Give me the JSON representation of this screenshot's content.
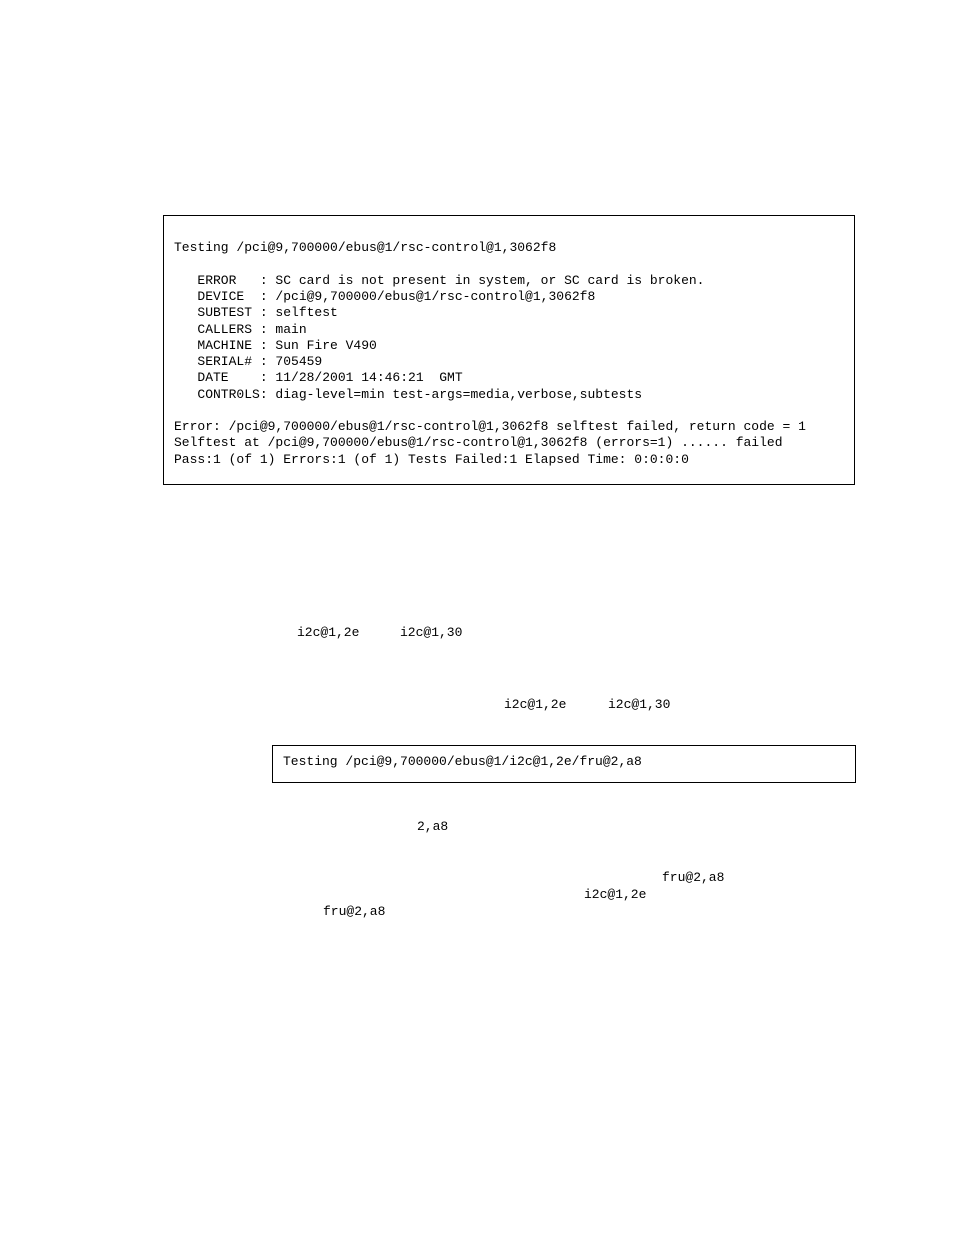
{
  "codebox1": "\nTesting /pci@9,700000/ebus@1/rsc-control@1,3062f8\n\n   ERROR   : SC card is not present in system, or SC card is broken.\n   DEVICE  : /pci@9,700000/ebus@1/rsc-control@1,3062f8\n   SUBTEST : selftest\n   CALLERS : main\n   MACHINE : Sun Fire V490\n   SERIAL# : 705459\n   DATE    : 11/28/2001 14:46:21  GMT\n   CONTR0LS: diag-level=min test-args=media,verbose,subtests\n\nError: /pci@9,700000/ebus@1/rsc-control@1,3062f8 selftest failed, return code = 1\nSelftest at /pci@9,700000/ebus@1/rsc-control@1,3062f8 (errors=1) ...... failed\nPass:1 (of 1) Errors:1 (of 1) Tests Failed:1 Elapsed Time: 0:0:0:0",
  "line1a": "i2c@1,2e",
  "line1b": "i2c@1,30",
  "line2a": "i2c@1,2e",
  "line2b": "i2c@1,30",
  "codebox2": "Testing /pci@9,700000/ebus@1/i2c@1,2e/fru@2,a8",
  "line3": "2,a8",
  "line4a": "fru@2,a8",
  "line4b": "i2c@1,2e",
  "line5": "fru@2,a8"
}
